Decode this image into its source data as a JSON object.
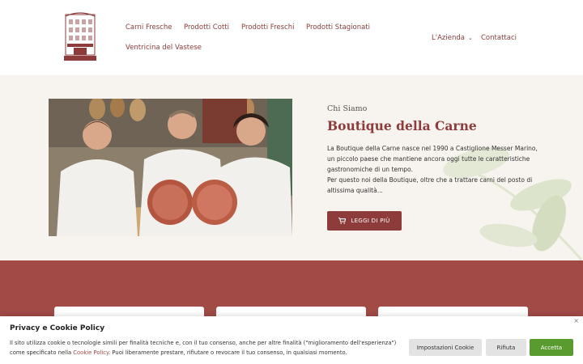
{
  "header": {
    "logo_alt": "Boutique della Carne",
    "nav": {
      "carni_fresche": "Carni Fresche",
      "prodotti_cotti": "Prodotti Cotti",
      "prodotti_freschi": "Prodotti Freschi",
      "prodotti_stagionati": "Prodotti Stagionati",
      "ventricina": "Ventricina del Vastese",
      "azienda": "L'Azienda",
      "contattaci": "Contattaci"
    }
  },
  "hero": {
    "kicker": "Chi Siamo",
    "title": "Boutique della Carne",
    "paragraph1": "La Boutique della Carne nasce nel 1990 a Castiglione Messer Marino, un piccolo paese che mantiene ancora oggi tutte le caratteristiche gastronomiche di un tempo.",
    "paragraph2": "Per questo noi della Boutique, oltre che a trattare carni del posto di altissima qualità...",
    "cta_label": "LEGGI DI PIÙ",
    "cta_icon": "cart-icon"
  },
  "cookie": {
    "title": "Privacy e Cookie Policy",
    "text_before_link": "Il sito utilizza cookie o tecnologie simili per finalità tecniche e, con il tuo consenso, anche per altre finalità (\"miglioramento dell'esperienza\") come specificato nella ",
    "link_label": "Cookie Policy",
    "text_after_link": ". Puoi liberamente prestare, rifiutare o revocare il tuo consenso, in qualsiasi momento.",
    "btn_settings": "Impostazioni Cookie",
    "btn_reject": "Rifiuta",
    "btn_accept": "Accetta",
    "close_glyph": "×"
  },
  "colors": {
    "brand": "#8e3b3b",
    "band": "#a14a46",
    "accept": "#5a9b2f",
    "grey_btn": "#e3e3e3"
  }
}
